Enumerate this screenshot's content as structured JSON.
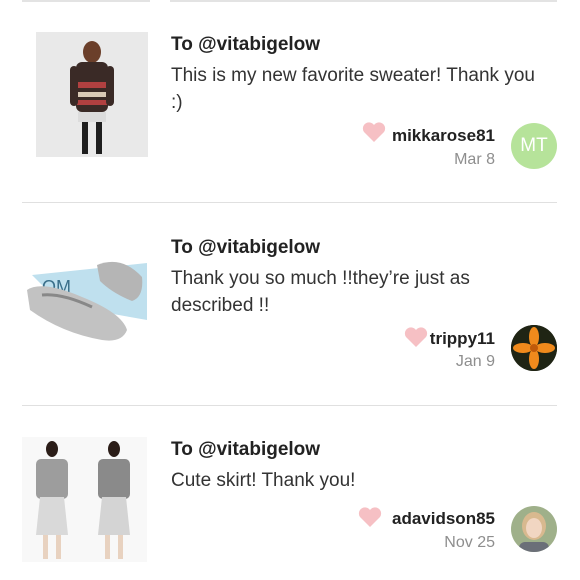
{
  "reviews": [
    {
      "to": "To @vitabigelow",
      "message": "This is my new favorite sweater! Thank you :)",
      "username": "mikkarose81",
      "date": "Mar 8",
      "avatar_initials": "MT",
      "thumb_icon": "sweater-photo"
    },
    {
      "to": "To @vitabigelow",
      "message": "Thank you so much !!they’re just as described !!",
      "username": "trippy11",
      "date": "Jan 9",
      "avatar_initials": "",
      "thumb_icon": "glitter-shoes-photo"
    },
    {
      "to": "To @vitabigelow",
      "message": "Cute skirt! Thank you!",
      "username": "adavidson85",
      "date": "Nov 25",
      "avatar_initials": "",
      "thumb_icon": "skirt-photo"
    }
  ],
  "colors": {
    "heart": "#f6c0c4",
    "avatar_mt": "#b6e39a",
    "text": "#222222",
    "muted": "#8e8e8e"
  }
}
